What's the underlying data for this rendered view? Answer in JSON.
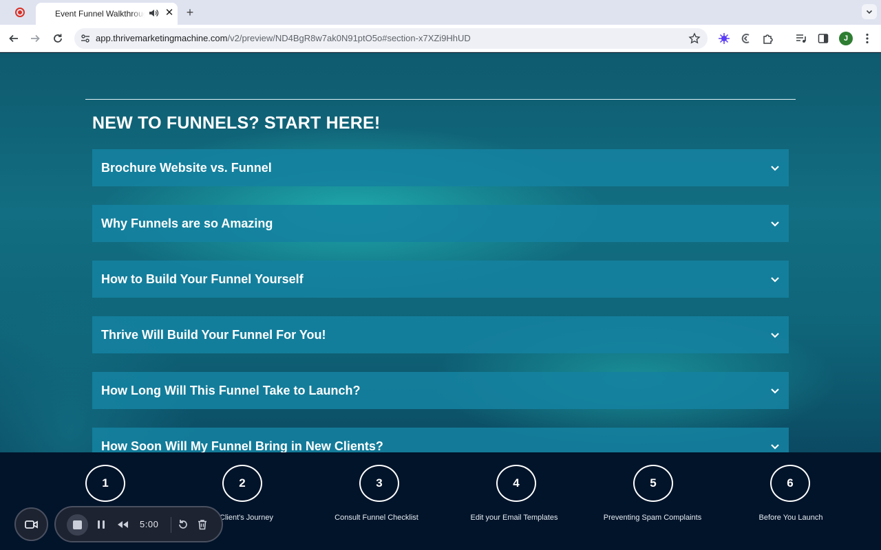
{
  "browser": {
    "tab_title": "Event Funnel Walkthrough",
    "url_host": "app.thrivemarketingmachine.com",
    "url_path": "/v2/preview/ND4BgR8w7ak0N91ptO5o#section-x7XZi9HhUD",
    "profile_initial": "J",
    "recording_indicator_color": "#d93025"
  },
  "page": {
    "heading": "NEW TO FUNNELS? START HERE!",
    "faq_items": [
      {
        "label": "Brochure Website vs. Funnel"
      },
      {
        "label": "Why Funnels are so Amazing"
      },
      {
        "label": "How to Build Your Funnel Yourself"
      },
      {
        "label": "Thrive Will Build Your Funnel For You!"
      },
      {
        "label": "How Long Will This Funnel Take to Launch?"
      },
      {
        "label": "How Soon Will My Funnel Bring in New Clients?"
      }
    ],
    "accent_color": "#1482a0"
  },
  "steps": [
    {
      "number": "1",
      "label": ""
    },
    {
      "number": "2",
      "label": "Client's Journey"
    },
    {
      "number": "3",
      "label": "Consult Funnel Checklist"
    },
    {
      "number": "4",
      "label": "Edit your Email Templates"
    },
    {
      "number": "5",
      "label": "Preventing Spam Complaints"
    },
    {
      "number": "6",
      "label": "Before You Launch"
    }
  ],
  "recorder": {
    "timer": "5:00",
    "icons": [
      "camera-icon",
      "stop-icon",
      "pause-icon",
      "rewind-icon",
      "restart-icon",
      "trash-icon"
    ]
  }
}
